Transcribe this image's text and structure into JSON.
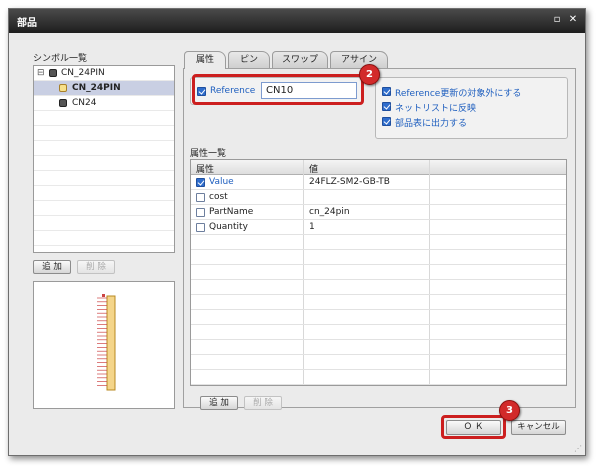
{
  "window": {
    "title": "部品",
    "maximize_icon": "maximize-icon",
    "close_icon": "close-icon"
  },
  "symbols": {
    "title": "シンボル一覧",
    "items": [
      {
        "label": "CN_24PIN",
        "expander": "⊟",
        "selected": false
      },
      {
        "label": "CN_24PIN",
        "selected": true
      },
      {
        "label": "CN24",
        "selected": false
      }
    ],
    "add": "追 加",
    "delete": "削 除"
  },
  "tabs": [
    {
      "label": "属性",
      "active": true
    },
    {
      "label": "ピン"
    },
    {
      "label": "スワップ"
    },
    {
      "label": "アサイン"
    }
  ],
  "reference": {
    "label": "Reference",
    "checked": true,
    "value": "CN10"
  },
  "options": [
    {
      "label": "Reference更新の対象外にする",
      "checked": true
    },
    {
      "label": "ネットリストに反映",
      "checked": true
    },
    {
      "label": "部品表に出力する",
      "checked": true
    }
  ],
  "attributes": {
    "title": "属性一覧",
    "columns": [
      "属性",
      "値"
    ],
    "rows": [
      {
        "name": "Value",
        "value": "24FLZ-SM2-GB-TB",
        "checked": true
      },
      {
        "name": "cost",
        "value": "",
        "checked": false
      },
      {
        "name": "PartName",
        "value": "cn_24pin",
        "checked": false
      },
      {
        "name": "Quantity",
        "value": "1",
        "checked": false
      }
    ],
    "add": "追 加",
    "delete": "削 除"
  },
  "footer": {
    "ok": "Ｏ Ｋ",
    "cancel": "キャンセル"
  },
  "markers": {
    "two": "2",
    "three": "3"
  },
  "colors": {
    "accent_blue": "#1f5fbf",
    "highlight_red": "#cc1f1f",
    "selection": "#c9cfe3"
  }
}
